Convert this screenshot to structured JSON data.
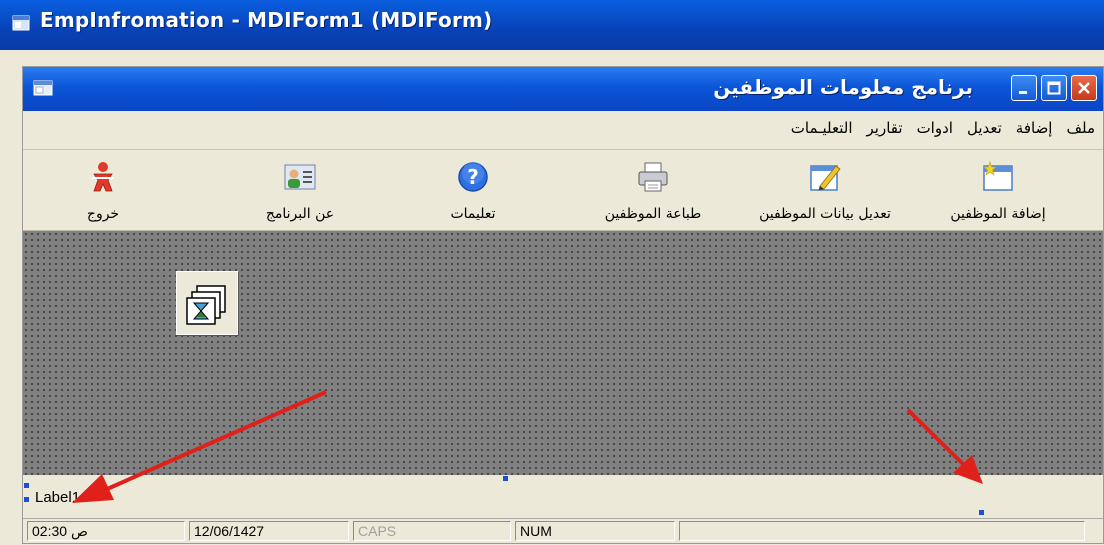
{
  "outer_window": {
    "title": "EmpInfromation - MDIForm1 (MDIForm)"
  },
  "mdi_window": {
    "title": "برنامج معلومات  الموظفين",
    "controls": {
      "close": "close-icon",
      "maximize": "maximize-icon",
      "minimize": "minimize-icon"
    }
  },
  "menu": {
    "items": [
      {
        "label": "ملف"
      },
      {
        "label": "إضافة"
      },
      {
        "label": "تعديل"
      },
      {
        "label": "ادوات"
      },
      {
        "label": "تقارير"
      },
      {
        "label": "التعليـمات"
      }
    ]
  },
  "toolbar": {
    "buttons": [
      {
        "label": "إضافة الموظفين",
        "icon": "new-window-icon"
      },
      {
        "label": "تعديل بيانات الموظفين",
        "icon": "edit-document-icon"
      },
      {
        "label": "طباعة الموظفين",
        "icon": "printer-icon"
      },
      {
        "label": "تعليمات",
        "icon": "help-icon"
      },
      {
        "label": "عن البرنامج",
        "icon": "user-card-icon"
      },
      {
        "label": "خروج",
        "icon": "exit-icon"
      }
    ]
  },
  "client_area": {
    "timer_icon": "timer-control-icon"
  },
  "label_control": {
    "text": "Label1"
  },
  "status_bar": {
    "time": "02:30 ص",
    "date": "12/06/1427",
    "caps": "CAPS",
    "num": "NUM"
  },
  "colors": {
    "title_bar": "#0a4fd0",
    "client_area": "#808080",
    "annotation_arrow": "#e0201a",
    "caps_disabled_text": "#a0a0a0"
  }
}
